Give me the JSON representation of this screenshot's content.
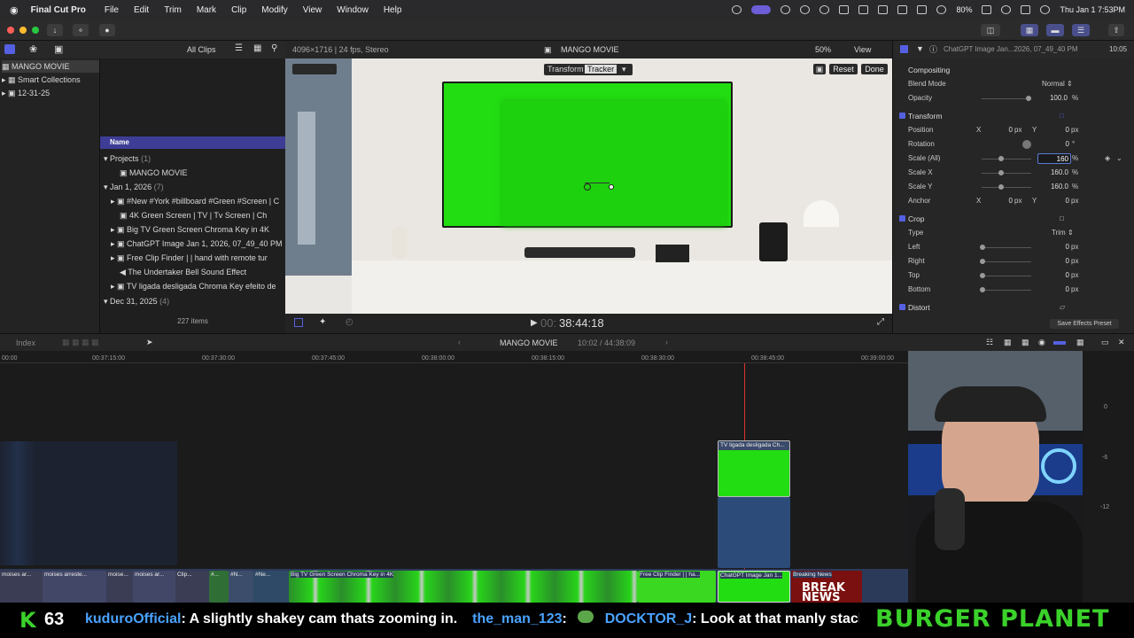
{
  "menubar": {
    "app_name": "Final Cut Pro",
    "items": [
      "File",
      "Edit",
      "Trim",
      "Mark",
      "Clip",
      "Modify",
      "View",
      "Window",
      "Help"
    ],
    "battery": "80%",
    "clock": "Thu Jan 1  7:53PM"
  },
  "library": {
    "root": "MANGO MOVIE",
    "items": [
      "Smart Collections",
      "12-31-25"
    ]
  },
  "browser": {
    "filter": "All Clips",
    "column_name": "Name",
    "item_count": "227 items",
    "rows": [
      {
        "label": "Projects",
        "count": "(1)"
      },
      {
        "label": "MANGO MOVIE"
      },
      {
        "label": "Jan 1, 2026",
        "count": "(7)"
      },
      {
        "label": "#New #York #billboard #Green #Screen | C"
      },
      {
        "label": "4K Green Screen  |  TV  |  Tv Screen  |  Ch"
      },
      {
        "label": "Big TV Green Screen Chroma Key in 4K"
      },
      {
        "label": "ChatGPT Image Jan 1, 2026, 07_49_40 PM"
      },
      {
        "label": "Free Clip  Finder  |  |  hand with remote tur"
      },
      {
        "label": "The Undertaker Bell   Sound Effect"
      },
      {
        "label": "TV ligada desligada Chroma Key efeito de"
      },
      {
        "label": "Dec 31, 2025",
        "count": "(4)"
      }
    ]
  },
  "viewer": {
    "format": "4096×1716 | 24 fps, Stereo",
    "title": "MANGO MOVIE",
    "zoom": "50%",
    "view_label": "View",
    "tab_transform": "Transform",
    "tab_tracker": "Tracker",
    "reset": "Reset",
    "done": "Done",
    "timecode": "38:44:18",
    "timecode_prefix": "00:"
  },
  "inspector": {
    "clip_name": "ChatGPT Image Jan...2026, 07_49_40 PM",
    "duration": "10:05",
    "compositing": "Compositing",
    "blend_mode_label": "Blend Mode",
    "blend_mode_value": "Normal",
    "opacity_label": "Opacity",
    "opacity_value": "100.0",
    "transform": "Transform",
    "position_label": "Position",
    "position_x": "0",
    "position_y": "0",
    "rotation_label": "Rotation",
    "rotation_value": "0",
    "scale_all_label": "Scale (All)",
    "scale_all_value": "160",
    "scale_x_label": "Scale X",
    "scale_x_value": "160.0",
    "scale_y_label": "Scale Y",
    "scale_y_value": "160.0",
    "anchor_label": "Anchor",
    "anchor_x": "0",
    "anchor_y": "0",
    "crop": "Crop",
    "type_label": "Type",
    "type_value": "Trim",
    "left_label": "Left",
    "right_label": "Right",
    "top_label": "Top",
    "bottom_label": "Bottom",
    "zero": "0",
    "px": "px",
    "pct": "%",
    "deg": "°",
    "x": "X",
    "y": "Y",
    "distort": "Distort",
    "save_preset": "Save Effects Preset"
  },
  "timeline": {
    "index": "Index",
    "project": "MANGO MOVIE",
    "duration": "10:02 / 44:38:09",
    "ruler": [
      "00:00",
      "00:37:15:00",
      "00:37:30:00",
      "00:37:45:00",
      "00:38:00:00",
      "00:38:15:00",
      "00:38:30:00",
      "00:38:45:00",
      "00:39:00:00",
      "00:39:15:00"
    ],
    "connected_clip": "TV ligada desligada Ch...",
    "storyline": [
      "moises ar...",
      "moises arreste...",
      "moise...",
      "moises ar...",
      "Clip...",
      "#...",
      "#N...",
      "#Ne...",
      "Big TV Green Screen Chroma Key in 4K",
      "Free Clip  Finder  |  |  ha...",
      "ChatGPT Image Jan 1...",
      "Breaking News"
    ],
    "meter": [
      "0",
      "-6",
      "-12"
    ]
  },
  "stream": {
    "score": "63",
    "chat": [
      {
        "user": "kuduroOfficial",
        "message": ": A slightly shakey cam thats zooming in."
      },
      {
        "user": "the_man_123",
        "message": ":"
      },
      {
        "user": "DOCKTOR_J",
        "message": ": Look at that manly stache"
      }
    ],
    "sponsor": "BURGER PLANET",
    "breaking": "BREAK NEWS"
  },
  "colors": {
    "accent": "#5460e0",
    "chroma": "#22dd11",
    "chat_user": "#4aa3ff",
    "sponsor": "#3bd12b"
  }
}
